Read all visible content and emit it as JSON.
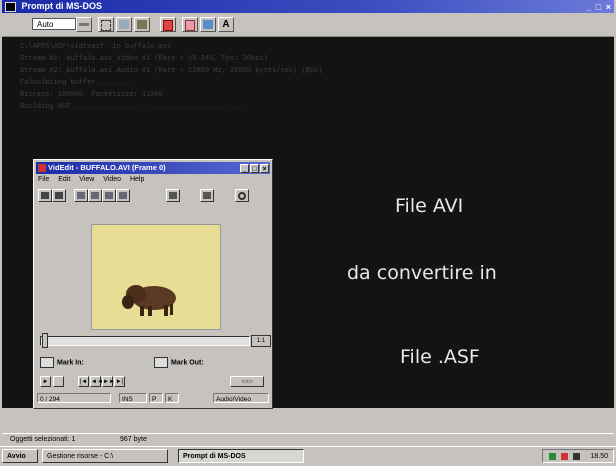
{
  "dos_window": {
    "title": "Prompt di MS-DOS",
    "controls": "_ □ ×",
    "toolbar": {
      "font_size": "Auto",
      "buttons": [
        "dropdown-arrow-icon",
        "mark-icon",
        "copy-icon",
        "paste-icon",
        "fullscreen-icon",
        "properties-icon",
        "background-icon",
        "font-icon"
      ],
      "font_button_label": "A"
    },
    "console_lines": [
      "C:\\APPS\\ASF\\vidtoasf -in buffalo.avi",
      "Stream #1: buffalo.avi Video #1 (Rate = 15.249, Fps: 30bps)",
      "Stream #2: buffalo.avi Audio #1 (Rate = 22050 Hz, 22050 bytes/sec) (Bps)",
      "Calculating buffer.........",
      "Bitrate: 100000  Packetsize: 11500",
      "Building ASF........................................."
    ],
    "overlay": {
      "line1": "File AVI",
      "line2": "da convertire in",
      "line3": "File .ASF"
    },
    "status": {
      "selected": "Oggetti selezionati: 1",
      "size": "967 byte"
    }
  },
  "videdit_window": {
    "title": "VidEdit - BUFFALO.AVI (Frame 0)",
    "controls": [
      "_",
      "□",
      "×"
    ],
    "menu": [
      "File",
      "Edit",
      "View",
      "Video",
      "Help"
    ],
    "toolbar_icons": [
      "open-icon",
      "save-icon",
      "cut-icon",
      "copy-icon",
      "paste-icon",
      "edit-icon",
      "film-icon",
      "compress-icon",
      "find-icon"
    ],
    "zoom_label": "1:1",
    "mark_in": "Mark In:",
    "mark_out": "Mark Out:",
    "playback_buttons": [
      "play-icon",
      "stop-icon",
      "first-frame-icon",
      "rewind-icon",
      "forward-icon",
      "last-frame-icon"
    ],
    "status": {
      "frame": "0 / 294",
      "mode": "INS",
      "p": "P",
      "k": "K",
      "stream": "Audio/Video"
    }
  },
  "taskbar": {
    "start": "Avvio",
    "tasks": [
      "Gestione risorse - C:\\",
      "Prompt di MS-DOS"
    ],
    "clock": "18.50"
  },
  "colors": {
    "title_bar": "#1a2aa8",
    "console_bg": "#131313",
    "overlay_text": "#e8e8e8",
    "window_face": "#c6c3be"
  }
}
